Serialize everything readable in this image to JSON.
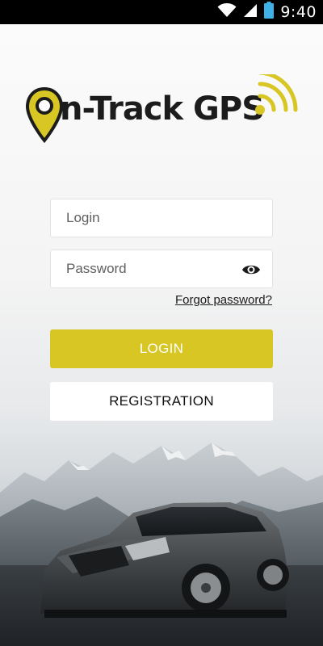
{
  "status_bar": {
    "time": "9:40",
    "icons": [
      "wifi-icon",
      "cellular-signal-icon",
      "battery-icon"
    ]
  },
  "logo": {
    "text": "n-Track GPS",
    "icon": "map-pin-icon",
    "signal_icon": "signal-arcs-icon"
  },
  "form": {
    "login_placeholder": "Login",
    "password_placeholder": "Password",
    "show_password_icon": "eye-icon",
    "forgot_password": "Forgot password?",
    "login_button": "LOGIN",
    "registration_button": "REGISTRATION"
  },
  "colors": {
    "accent": "#d7c623",
    "text_dark": "#1c1c1c",
    "status_bar": "#000000",
    "battery": "#3fb0e8"
  }
}
